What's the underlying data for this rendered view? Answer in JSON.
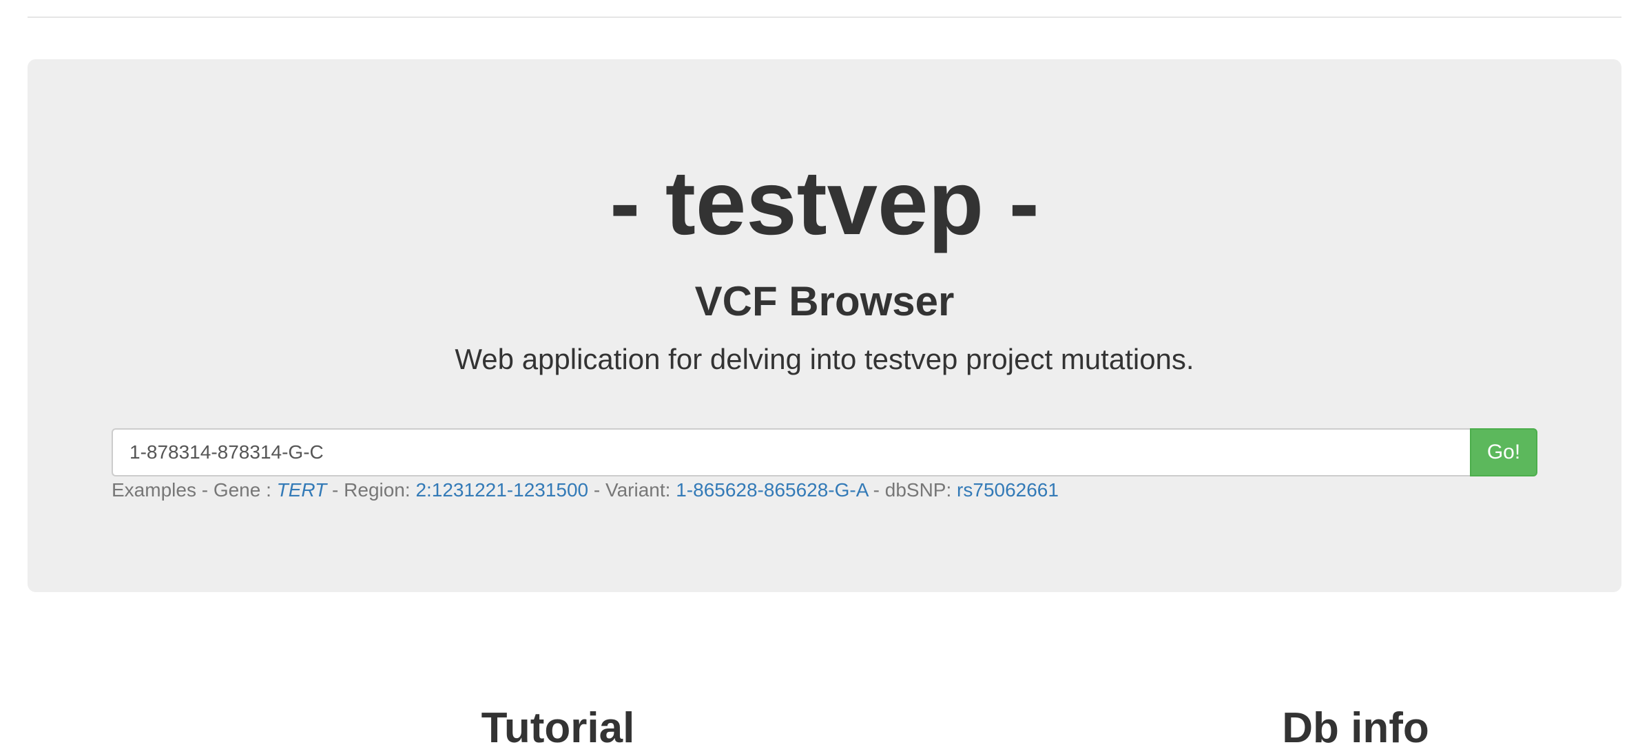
{
  "header": {
    "title": "- testvep -",
    "subtitle": "VCF Browser",
    "description": "Web application for delving into testvep project mutations."
  },
  "search": {
    "value": "1-878314-878314-G-C",
    "placeholder": "",
    "button_label": "Go!"
  },
  "examples": {
    "prefix": "Examples - Gene : ",
    "gene": "TERT",
    "region_label": " - Region: ",
    "region": "2:1231221-1231500",
    "variant_label": " - Variant: ",
    "variant": "1-865628-865628-G-A",
    "dbsnp_label": " - dbSNP: ",
    "dbsnp": "rs75062661"
  },
  "sections": {
    "tutorial": "Tutorial",
    "db_info": "Db info"
  },
  "colors": {
    "jumbotron_bg": "#eeeeee",
    "go_button": "#5cb85c",
    "link": "#337ab7"
  }
}
